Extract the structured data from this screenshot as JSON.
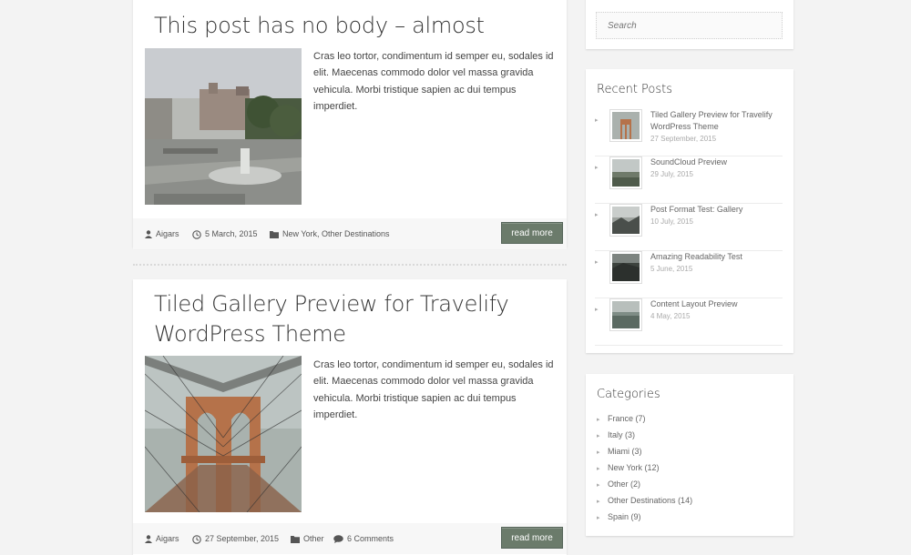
{
  "colors": {
    "accent": "#6b7b6b",
    "background": "#f3f3f3"
  },
  "posts": [
    {
      "title": "This post has no body – almost",
      "excerpt": "Cras leo tortor, condimentum id semper eu, sodales id elit. Maecenas commodo dolor vel massa gravida vehicula. Morbi tristique sapien ac dui tempus imperdiet.",
      "author": "Aigars",
      "date": "5 March, 2015",
      "categories": "New York, Other Destinations",
      "read_more": "read more"
    },
    {
      "title": "Tiled Gallery Preview for Travelify WordPress Theme",
      "excerpt": "Cras leo tortor, condimentum id semper eu, sodales id elit. Maecenas commodo dolor vel massa gravida vehicula. Morbi tristique sapien ac dui tempus imperdiet.",
      "author": "Aigars",
      "date": "27 September, 2015",
      "categories": "Other",
      "comments": "6 Comments",
      "read_more": "read more"
    }
  ],
  "search": {
    "placeholder": "Search"
  },
  "recent_posts": {
    "title": "Recent Posts",
    "items": [
      {
        "title": "Tiled Gallery Preview for Travelify WordPress Theme",
        "date": "27 September, 2015"
      },
      {
        "title": "SoundCloud Preview",
        "date": "29 July, 2015"
      },
      {
        "title": "Post Format Test: Gallery",
        "date": "10 July, 2015"
      },
      {
        "title": "Amazing Readability Test",
        "date": "5 June, 2015"
      },
      {
        "title": "Content Layout Preview",
        "date": "4 May, 2015"
      }
    ]
  },
  "categories": {
    "title": "Categories",
    "items": [
      {
        "name": "France",
        "count": "(7)"
      },
      {
        "name": "Italy",
        "count": "(3)"
      },
      {
        "name": "Miami",
        "count": "(3)"
      },
      {
        "name": "New York",
        "count": "(12)"
      },
      {
        "name": "Other",
        "count": "(2)"
      },
      {
        "name": "Other Destinations",
        "count": "(14)"
      },
      {
        "name": "Spain",
        "count": "(9)"
      }
    ]
  }
}
